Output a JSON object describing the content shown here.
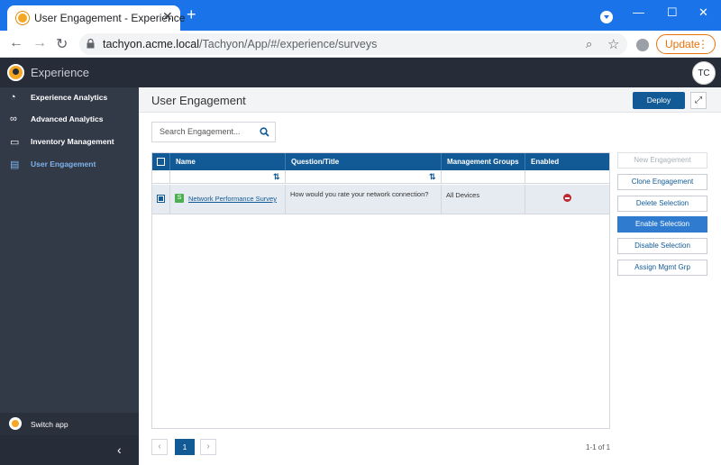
{
  "browser": {
    "tab_title": "User Engagement - Experience",
    "url_host": "tachyon.acme.local",
    "url_path": "/Tachyon/App/#/experience/surveys",
    "update_label": "Update"
  },
  "app": {
    "name": "Experience",
    "user_initials": "TC"
  },
  "sidebar": {
    "items": [
      {
        "label": "Experience Analytics",
        "icon": "dashboard-icon"
      },
      {
        "label": "Advanced Analytics",
        "icon": "binoculars-icon"
      },
      {
        "label": "Inventory Management",
        "icon": "monitor-icon"
      },
      {
        "label": "User Engagement",
        "icon": "clipboard-icon",
        "active": true
      }
    ],
    "switch_app": "Switch app"
  },
  "page": {
    "title": "User Engagement",
    "deploy_label": "Deploy"
  },
  "search": {
    "placeholder": "Search Engagement..."
  },
  "table": {
    "columns": [
      "Name",
      "Question/Title",
      "Management Groups",
      "Enabled"
    ],
    "rows": [
      {
        "type_badge": "S",
        "name": "Network Performance Survey",
        "question": "How would you rate your network connection?",
        "groups": "All Devices",
        "enabled": false
      }
    ]
  },
  "actions": [
    {
      "label": "New Engagement",
      "state": "disabled"
    },
    {
      "label": "Clone Engagement",
      "state": "normal"
    },
    {
      "label": "Delete Selection",
      "state": "normal"
    },
    {
      "label": "Enable Selection",
      "state": "primary"
    },
    {
      "label": "Disable Selection",
      "state": "normal"
    },
    {
      "label": "Assign Mgmt Grp",
      "state": "normal"
    }
  ],
  "pagination": {
    "current_page": "1",
    "info": "1-1 of 1"
  },
  "colors": {
    "primary": "#125a96",
    "sidebar_bg": "#323a48",
    "header_bg": "#262c38",
    "browser_blue": "#1a73e8"
  }
}
